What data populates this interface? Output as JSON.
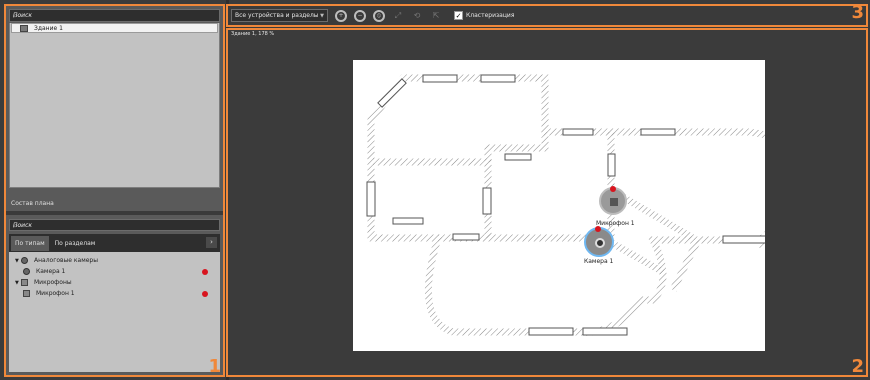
{
  "left_panel": {
    "search_placeholder": "Поиск",
    "tree_items": [
      {
        "label": "Здание 1",
        "icon": "building-icon"
      }
    ],
    "composition_label": "Состав плана",
    "search2_placeholder": "Поиск",
    "tabs": [
      {
        "label": "По типам",
        "active": true
      },
      {
        "label": "По разделам",
        "active": false
      }
    ],
    "groups": [
      {
        "label": "Аналоговые камеры",
        "icon": "camera-group-icon",
        "children": [
          {
            "label": "Камера 1",
            "status": "alarm"
          }
        ]
      },
      {
        "label": "Микрофоны",
        "icon": "microphone-group-icon",
        "children": [
          {
            "label": "Микрофон 1",
            "status": "alarm"
          }
        ]
      }
    ],
    "panel_number": "1"
  },
  "toolbar": {
    "dropdown_value": "Все устройства и разделы",
    "clustering_label": "Кластеризация",
    "clustering_checked": true,
    "panel_number": "3"
  },
  "main": {
    "zoom_label": "Здание 1, 178 %",
    "camera_label": "Камера 1",
    "microphone_label": "Микрофон 1",
    "panel_number": "2"
  },
  "colors": {
    "accent": "#f0883a",
    "alarm": "#d8141e"
  }
}
